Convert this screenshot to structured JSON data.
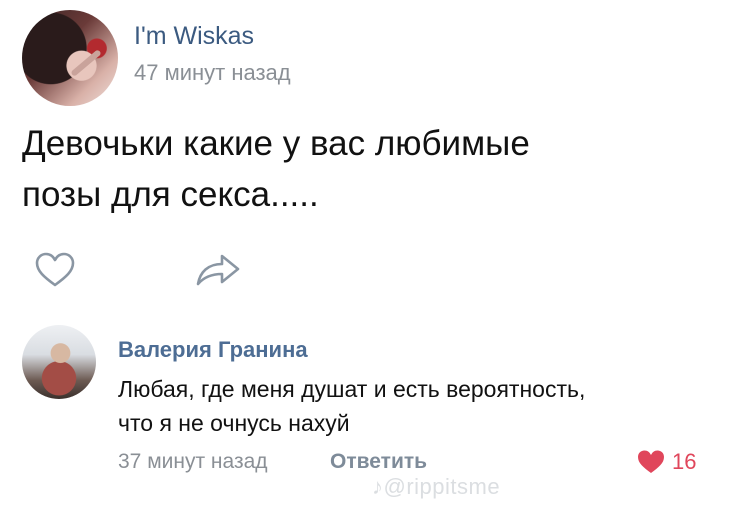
{
  "post": {
    "author": "I'm Wiskas",
    "time": "47 минут назад",
    "text_line1": "Девочьки какие у вас любимые",
    "text_line2": "позы для секса....."
  },
  "actions": {
    "like_icon": "heart-outline-icon",
    "share_icon": "share-arrow-icon"
  },
  "comment": {
    "author": "Валерия Гранина",
    "text_line1": "Любая, где меня душат и есть вероятность,",
    "text_line2": "что я не очнусь нахуй",
    "time": "37 минут назад",
    "reply_label": "Ответить",
    "likes": "16",
    "like_color": "#e0465b"
  },
  "watermark": {
    "text": "♪@rippitsme"
  },
  "colors": {
    "author_link": "#3b5a80",
    "muted": "#8a8f95",
    "commenter_link": "#4d6d94"
  }
}
